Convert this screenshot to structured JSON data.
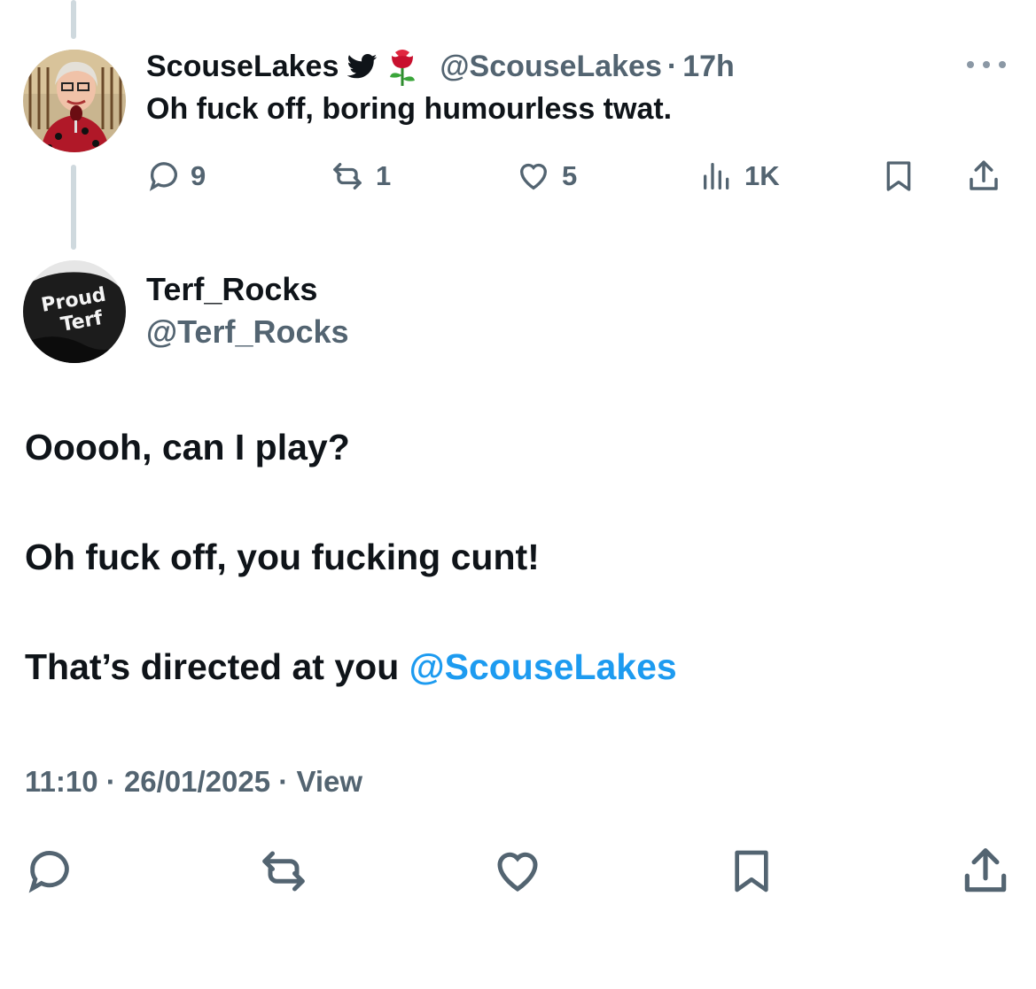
{
  "reply": {
    "display_name": "ScouseLakes",
    "handle": "@ScouseLakes",
    "separator": "·",
    "time": "17h",
    "text": "Oh fuck off, boring humourless twat.",
    "badge_icons": [
      "bird-icon",
      "rose-emoji-icon"
    ],
    "actions": {
      "replies": "9",
      "reposts": "1",
      "likes": "5",
      "views": "1K"
    }
  },
  "main_tweet": {
    "display_name": "Terf_Rocks",
    "handle": "@Terf_Rocks",
    "avatar_text": [
      "Proud",
      "Terf"
    ],
    "lines": [
      "Ooooh, can I play?",
      "Oh fuck off, you fucking cunt!",
      "That’s directed at you "
    ],
    "mention": "@ScouseLakes",
    "meta": {
      "time": "11:10",
      "date": "26/01/2025",
      "separator": "·",
      "views_label": "View"
    }
  },
  "colors": {
    "text": "#0f1419",
    "secondary": "#536471",
    "link": "#1d9bf0",
    "thread_line": "#cfd9de"
  }
}
